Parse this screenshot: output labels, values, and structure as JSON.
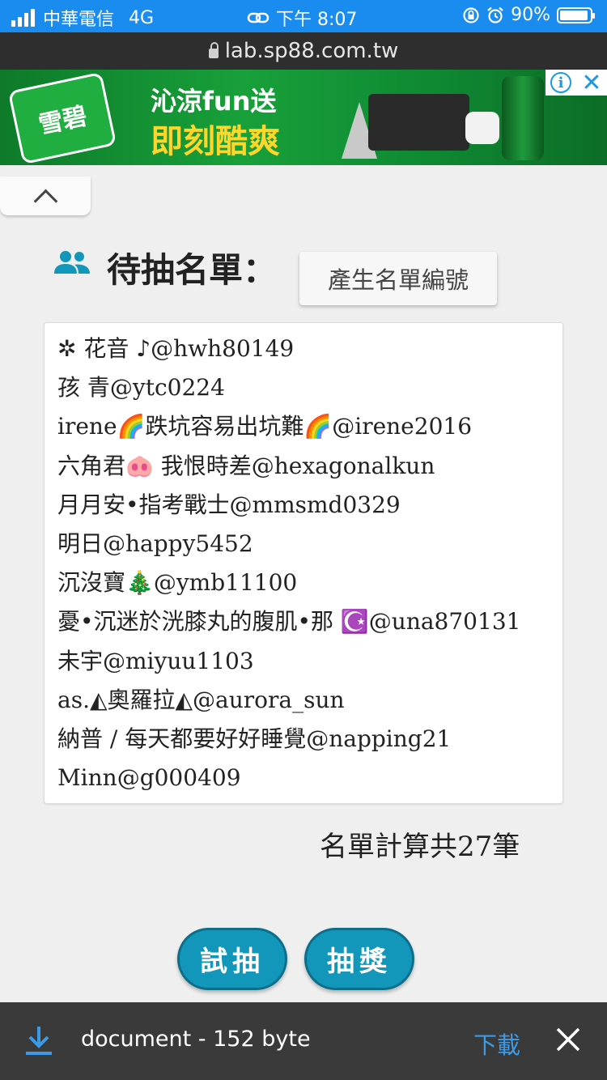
{
  "status_bar": {
    "carrier": "中華電信",
    "network": "4G",
    "time": "下午 8:07",
    "battery": "90%",
    "battery_level": 0.9
  },
  "browser": {
    "url": "lab.sp88.com.tw"
  },
  "ad": {
    "brand": "雪碧",
    "line1": "沁涼fun送",
    "line2": "即刻酷爽",
    "info_icon": "info-icon",
    "close_icon": "close-icon"
  },
  "collapse": {
    "icon": "chevron-up-icon"
  },
  "main": {
    "title": "待抽名單：",
    "title_icon": "people-icon",
    "generate_button": "產生名單編號",
    "names": [
      "✲ 花音 ♪@hwh80149",
      "孩 青@ytc0224",
      "irene🌈跌坑容易出坑難🌈@irene2016",
      "六角君🐽 我恨時差@hexagonalkun",
      "月月安•指考戰士@mmsmd0329",
      "明日@happy5452",
      "沉沒寶🎄@ymb11100",
      "憂•沉迷於洸膝丸的腹肌•那 ☪️@una870131",
      "未宇@miyuu1103",
      "as.◭奧羅拉◭@aurora_sun",
      "納普 / 每天都要好好睡覺@napping21",
      "Minn@g000409",
      "❤️"
    ],
    "count_text": "名單計算共27筆",
    "trial_button": "試抽",
    "draw_button": "抽獎"
  },
  "download_bar": {
    "icon": "download-icon",
    "file_label": "document - 152 byte",
    "download_link": "下載",
    "close_icon": "close-icon"
  },
  "colors": {
    "status_bar": "#1a8cf0",
    "pill_button": "#1296b9",
    "link_blue": "#3b9be8",
    "people_icon": "#1296b9"
  }
}
